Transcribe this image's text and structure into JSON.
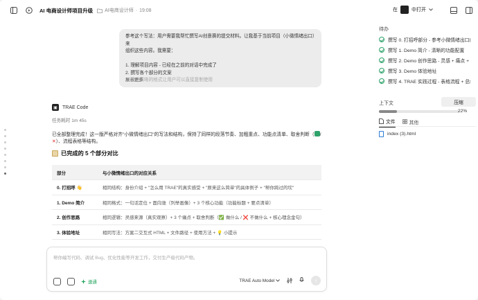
{
  "header": {
    "title": "AI 电商设计师项目升级",
    "workspace": "AI电商设计师",
    "time": "19:08",
    "open_in_prefix": "在",
    "open_in_label": "中打开"
  },
  "user_message": {
    "lines": [
      "参考这个写法：用户需要我帮忙撰写AI创意赛的提交材料。让我基于当前项目（小微情绪出口）来",
      "组织这些内容。我需要：",
      "",
      "1. 理解项目内容 - 已经在之前的对话中完成了",
      "2. 撰写各个部分的文案"
    ],
    "faded_line": "3. 给出清晰的格式让用户可以直接复制使用",
    "show_more": "展示更多"
  },
  "agent": {
    "name": "TRAE Code",
    "elapsed": "任务耗时 1m 45s",
    "done_text_a": "已全部整理完成！这一版严格对齐\"小微情绪出口\"的写法和结构，保持了同样的段落节奏、加粗重点、功能点清单、取舍判断（",
    "done_text_b": "/",
    "done_text_c": "）、流程表格等结构。",
    "section_title": "已完成的 5 个部分对比"
  },
  "table": {
    "headers": [
      "部分",
      "与小微情绪出口的对应关系"
    ],
    "rows": [
      [
        "0. 打招呼 👋",
        "相同结构：身份介绍 + \"怎么用 TRAE\"的真实感受 + \"原来这么简单\"的具体例子 + \"帮你跨过的坎\""
      ],
      [
        "1. Demo 简介",
        "相同格式：一句话定位 + 面向谁（列举画像）+ 3 个核心功能（功能标题 + 要点清单）"
      ],
      [
        "2. 创作思路",
        "相同逻辑：灵感来源（真实观察）+ 3 个痛点 + 取舍判断（✅ 做什么 / ❌ 不做什么 + 核心理念金句）"
      ],
      [
        "3. 体验地址",
        "相同写法：方案二交互式 HTML + 文件路径 + 使用方法 + 💡 小提示"
      ]
    ]
  },
  "composer": {
    "placeholder": "帮你编写代码、调试 Bug、优化性能等开发工作，交付生产级代码产物。",
    "mode": "速通",
    "model": "TRAE Auto Model"
  },
  "panel": {
    "todo_title": "待办",
    "todos": [
      "撰写 0. 打招呼部分 - 参考小微情绪出口的写法",
      "撰写 1. Demo 简介 - 清晰的功能配置",
      "撰写 2. Demo 创作思路 - 灵感 + 痛点 + 取舍",
      "撰写 3. Demo 体验地址",
      "撰写 4. TRAE 实践过程 - 表格流程 + 总结"
    ],
    "context_label": "上下文",
    "compress_label": "压缩",
    "context_pct": "22%",
    "context_fill": 0.22,
    "tab_files": "文件",
    "tab_other": "其他",
    "file_name": "index (3).html"
  },
  "colors": {
    "accent_green": "#2ea36b",
    "file_blue": "#2b7bd8"
  }
}
